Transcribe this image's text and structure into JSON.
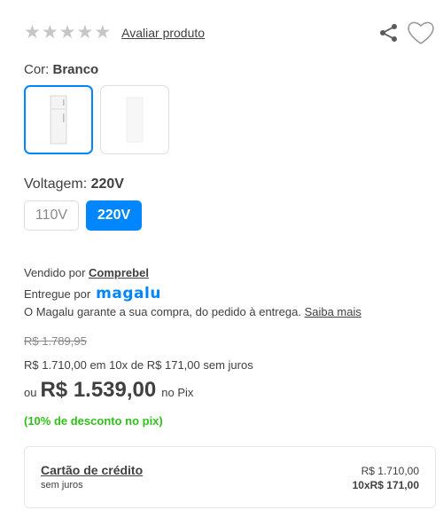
{
  "rating": {
    "stars": [
      "★",
      "★",
      "★",
      "★",
      "★"
    ],
    "rate_link": "Avaliar produto"
  },
  "icons": {
    "share": "share-icon",
    "favorite": "heart-icon"
  },
  "color": {
    "label": "Cor:",
    "selected": "Branco",
    "options": [
      "Branco",
      "Branco"
    ]
  },
  "voltage": {
    "label": "Voltagem:",
    "selected": "220V",
    "options": [
      "110V",
      "220V"
    ]
  },
  "seller": {
    "sold_by": "Vendido por",
    "seller_name": "Comprebel",
    "delivered_by": "Entregue por",
    "delivered_logo": "magalu",
    "guarantee_text": "O Magalu garante a sua compra, do pedido à entrega.",
    "guarantee_link": "Saiba mais"
  },
  "price": {
    "old": "R$ 1.789,95",
    "installments": "R$ 1.710,00 em 10x de R$ 171,00 sem juros",
    "pix_prefix": "ou",
    "pix_price": "R$ 1.539,00",
    "pix_suffix": "no Pix",
    "pix_discount": "(10% de desconto no pix)"
  },
  "payment_card": {
    "title": "Cartão de crédito",
    "subtitle": "sem juros",
    "total": "R$ 1.710,00",
    "installment": "10xR$ 171,00"
  },
  "colors": {
    "accent": "#0086ff",
    "discount_green": "#2fc11a",
    "star_gray": "#c6c6c6"
  }
}
